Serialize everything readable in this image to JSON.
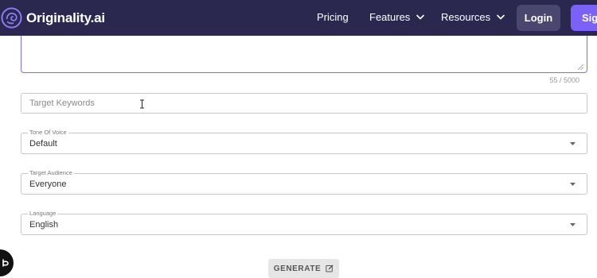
{
  "nav": {
    "brand": "Originality.ai",
    "links": [
      {
        "label": "Pricing"
      },
      {
        "label": "Features"
      },
      {
        "label": "Resources"
      }
    ],
    "login": "Login",
    "signup": "Sign"
  },
  "form": {
    "description": {
      "char_count": "55 / 5000"
    },
    "keywords": {
      "placeholder": "Target Keywords",
      "value": ""
    },
    "tone": {
      "label": "Tone Of Voice",
      "value": "Default"
    },
    "audience": {
      "label": "Target Audience",
      "value": "Everyone"
    },
    "language": {
      "label": "Language",
      "value": "English"
    },
    "generate_label": "GENERATE"
  },
  "colors": {
    "nav_bg": "#2b2850",
    "accent": "#7b61f5",
    "focus_border": "#7b6ef0",
    "login_bg": "#4a4670",
    "generate_bg": "#e6e6e6"
  },
  "icons": {
    "brand": "brain-icon",
    "dropdown": "chevron-down-icon",
    "select": "caret-down-icon",
    "generate": "edit-icon",
    "cursor": "text-cursor-icon",
    "floating": "help-chat-icon"
  }
}
